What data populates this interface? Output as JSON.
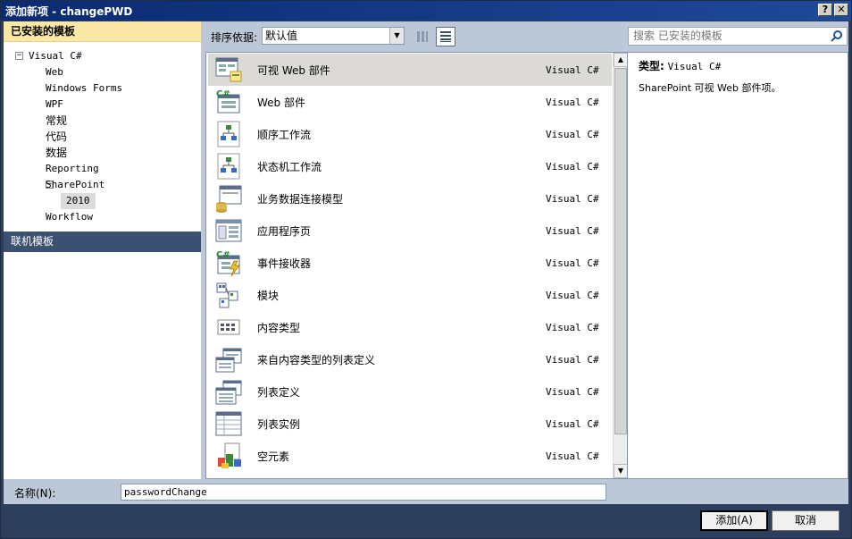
{
  "window": {
    "title": "添加新项 - changePWD",
    "help_btn": "?",
    "close_btn": "✕"
  },
  "left_panel": {
    "installed_header": "已安装的模板",
    "tree": [
      {
        "label": "Visual C#",
        "level": 0,
        "expander": "−"
      },
      {
        "label": "Web",
        "level": 1
      },
      {
        "label": "Windows Forms",
        "level": 1
      },
      {
        "label": "WPF",
        "level": 1
      },
      {
        "label": "常规",
        "level": 1
      },
      {
        "label": "代码",
        "level": 1
      },
      {
        "label": "数据",
        "level": 1
      },
      {
        "label": "Reporting",
        "level": 1
      },
      {
        "label": "SharePoint",
        "level": 1,
        "expander": "−"
      },
      {
        "label": "2010",
        "level": 2,
        "selected": true
      },
      {
        "label": "Workflow",
        "level": 1
      }
    ],
    "online_header": "联机模板"
  },
  "toolbar": {
    "sort_label": "排序依据:",
    "sort_value": "默认值",
    "search_placeholder": "搜索 已安装的模板"
  },
  "templates": [
    {
      "name": "可视 Web 部件",
      "lang": "Visual C#",
      "icon": "visual-web-part-icon",
      "selected": true
    },
    {
      "name": "Web 部件",
      "lang": "Visual C#",
      "icon": "web-part-icon"
    },
    {
      "name": "顺序工作流",
      "lang": "Visual C#",
      "icon": "sequential-workflow-icon"
    },
    {
      "name": "状态机工作流",
      "lang": "Visual C#",
      "icon": "state-machine-workflow-icon"
    },
    {
      "name": "业务数据连接模型",
      "lang": "Visual C#",
      "icon": "bdc-model-icon"
    },
    {
      "name": "应用程序页",
      "lang": "Visual C#",
      "icon": "application-page-icon"
    },
    {
      "name": "事件接收器",
      "lang": "Visual C#",
      "icon": "event-receiver-icon"
    },
    {
      "name": "模块",
      "lang": "Visual C#",
      "icon": "module-icon"
    },
    {
      "name": "内容类型",
      "lang": "Visual C#",
      "icon": "content-type-icon"
    },
    {
      "name": "来自内容类型的列表定义",
      "lang": "Visual C#",
      "icon": "list-def-from-content-type-icon"
    },
    {
      "name": "列表定义",
      "lang": "Visual C#",
      "icon": "list-definition-icon"
    },
    {
      "name": "列表实例",
      "lang": "Visual C#",
      "icon": "list-instance-icon"
    },
    {
      "name": "空元素",
      "lang": "Visual C#",
      "icon": "empty-element-icon"
    }
  ],
  "detail": {
    "type_label": "类型:",
    "type_value": "Visual C#",
    "description": "SharePoint 可视 Web 部件项。"
  },
  "name_field": {
    "label": "名称(N):",
    "value": "passwordChange"
  },
  "buttons": {
    "add": "添加(A)",
    "cancel": "取消"
  }
}
